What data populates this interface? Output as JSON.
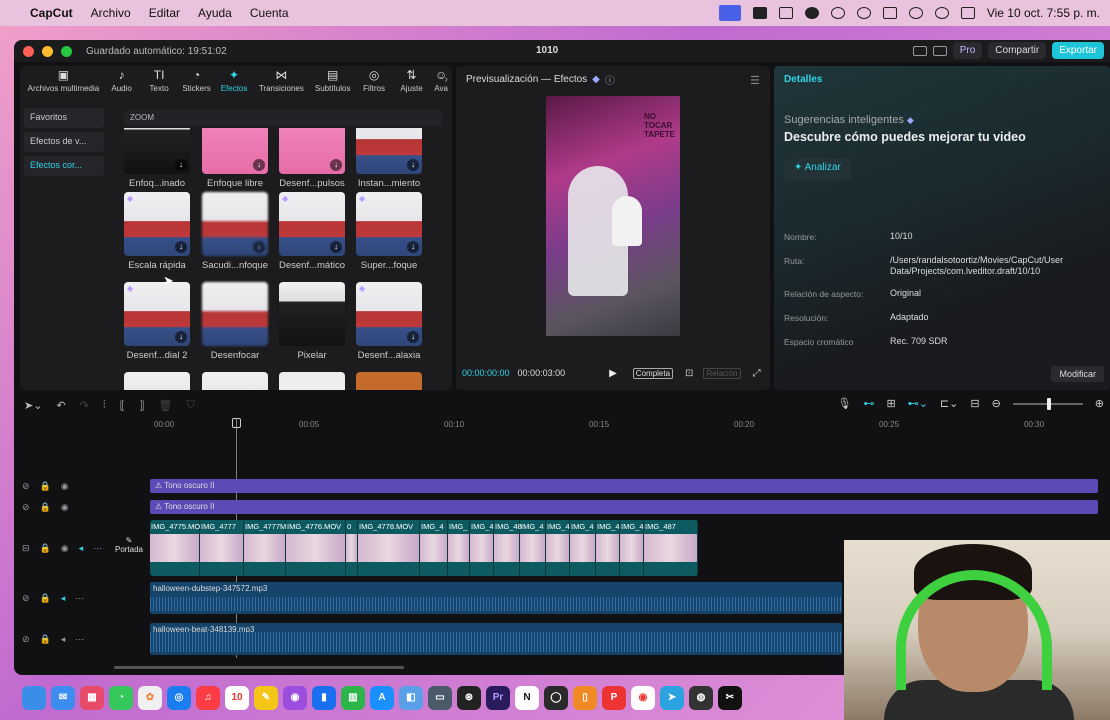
{
  "menubar": {
    "app": "CapCut",
    "items": [
      "Archivo",
      "Editar",
      "Ayuda",
      "Cuenta"
    ],
    "clock": "Vie 10 oct.  7:55 p. m."
  },
  "window": {
    "autosave": "Guardado automático: 19:51:02",
    "title": "1010",
    "pro_label": "Pro",
    "share_label": "Compartir",
    "export_label": "Exportar"
  },
  "toolbar": [
    {
      "label": "Archivos multimedia",
      "icon": "media-icon"
    },
    {
      "label": "Audio",
      "icon": "audio-icon"
    },
    {
      "label": "Texto",
      "icon": "text-icon"
    },
    {
      "label": "Stickers",
      "icon": "stickers-icon"
    },
    {
      "label": "Efectos",
      "icon": "effects-icon",
      "active": true
    },
    {
      "label": "Transiciones",
      "icon": "transitions-icon"
    },
    {
      "label": "Subtítulos",
      "icon": "subtitles-icon"
    },
    {
      "label": "Filtros",
      "icon": "filters-icon"
    },
    {
      "label": "Ajuste",
      "icon": "adjust-icon"
    },
    {
      "label": "Ava",
      "icon": "avatar-icon"
    }
  ],
  "sidebar": [
    "Favoritos",
    "Efectos de v...",
    "Efectos cor..."
  ],
  "category": "ZOOM",
  "effects": [
    [
      "Enfoq...inado",
      "Enfoque libre",
      "Desenf...pulsos",
      "Instan...miento"
    ],
    [
      "Escala rápida",
      "Sacudi...nfoque",
      "Desenf...mático",
      "Super...foque"
    ],
    [
      "Desenf...dial 2",
      "Desenfocar",
      "Pixelar",
      "Desenf...alaxia"
    ]
  ],
  "preview": {
    "title": "Previsualización — Efectos",
    "video_sign": "NO TOCAR TAPETE",
    "time_current": "00:00:00:00",
    "time_total": "00:00:03:00",
    "full_label": "Completa",
    "ratio_label": "Relación"
  },
  "details": {
    "title": "Detalles",
    "smart_title": "Sugerencias inteligentes",
    "headline": "Descubre cómo puedes mejorar tu video",
    "analyze_label": "Analizar",
    "rows": [
      {
        "label": "Nombre:",
        "value": "10/10"
      },
      {
        "label": "Ruta:",
        "value": "/Users/randalsotoortiz/Movies/CapCut/User Data/Projects/com.lveditor.draft/10/10"
      },
      {
        "label": "Relación de aspecto:",
        "value": "Original"
      },
      {
        "label": "Resolución:",
        "value": "Adaptado"
      },
      {
        "label": "Espacio cromático",
        "value": "Rec. 709 SDR"
      }
    ],
    "modify_label": "Modificar"
  },
  "timeline": {
    "ruler": [
      "00:00",
      "00:05",
      "00:10",
      "00:15",
      "00:20",
      "00:25",
      "00:30"
    ],
    "overlay_tracks": [
      "Tono oscuro II",
      "Tono oscuro II"
    ],
    "clips": [
      "IMG_4775.MO",
      "IMG_4777",
      "IMG_4777M",
      "IMG_4776.MOV",
      "0",
      "IMG_4778.MOV",
      "IMG_4",
      "IMG_",
      "IMG_4",
      "IMG_48",
      "IMG_4",
      "IMG_4",
      "IMG_4",
      "IMG_4",
      "IMG_4",
      "IMG_487"
    ],
    "cover_label": "Portada",
    "audio_tracks": [
      "halloween-dubstep-347572.mp3",
      "halloween-beat-348139.mp3"
    ]
  },
  "dock_apps": [
    "finder",
    "mail",
    "launchpad",
    "messages",
    "photos",
    "safari",
    "music",
    "calendar",
    "notes",
    "podcasts",
    "keynote",
    "numbers",
    "appstore",
    "preview",
    "notes2",
    "chatgpt",
    "premiere",
    "notion",
    "quicktime",
    "pages",
    "pdf",
    "chrome",
    "telegram",
    "obs",
    "capcut"
  ]
}
